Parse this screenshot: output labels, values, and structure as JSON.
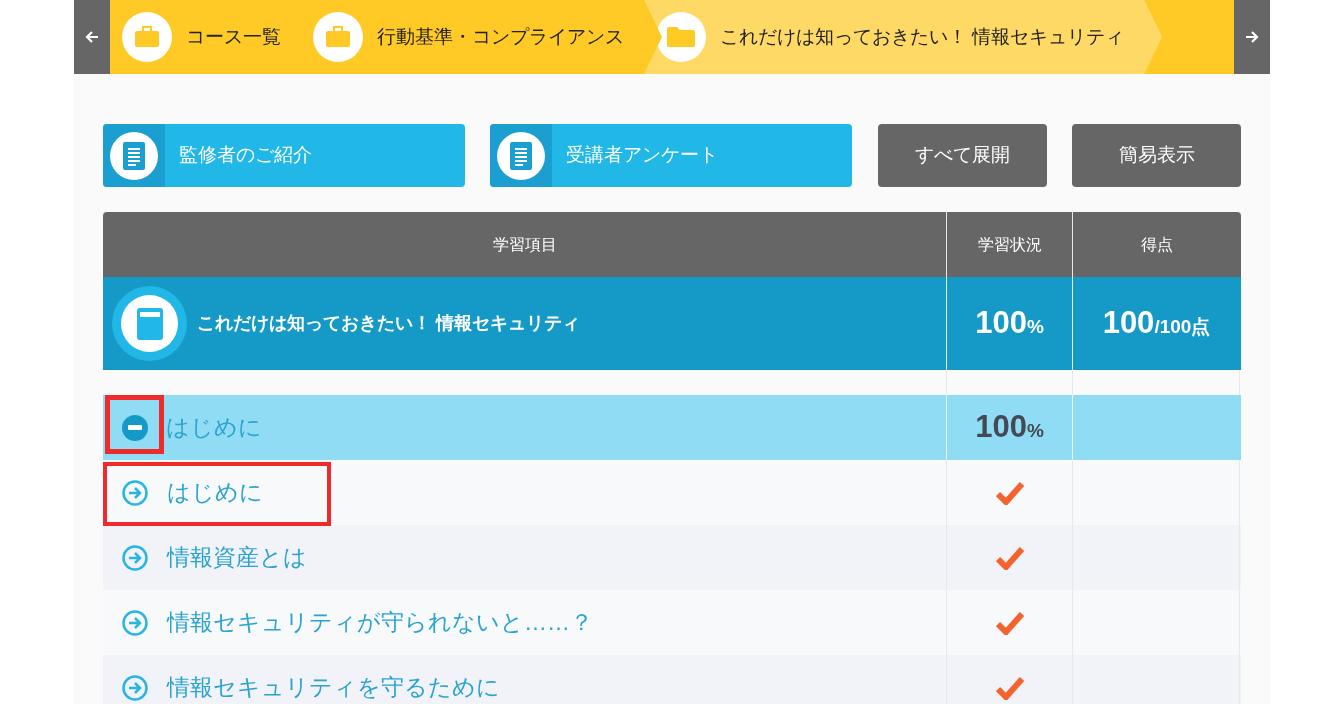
{
  "breadcrumb": {
    "items": [
      {
        "label": "コース一覧",
        "kind": "briefcase",
        "current": false
      },
      {
        "label": "行動基準・コンプライアンス",
        "kind": "briefcase",
        "current": false
      },
      {
        "label": "これだけは知っておきたい！ 情報セキュリティ",
        "kind": "folder",
        "current": true
      }
    ]
  },
  "buttons": [
    {
      "label": "監修者のご紹介",
      "kind": "document"
    },
    {
      "label": "受講者アンケート",
      "kind": "document"
    },
    {
      "label": "すべて展開",
      "kind": "plain"
    },
    {
      "label": "簡易表示",
      "kind": "plain"
    }
  ],
  "table": {
    "columns": [
      "学習項目",
      "学習状況",
      "得点"
    ],
    "course": {
      "title": "これだけは知っておきたい！ 情報セキュリティ",
      "progress": "100",
      "progress_unit": "%",
      "score": "100",
      "score_total": "/100点"
    },
    "sections": [
      {
        "title": "はじめに",
        "expanded": true,
        "highlighted": true,
        "progress": "100",
        "progress_unit": "%",
        "lessons": [
          {
            "title": "はじめに",
            "completed": true,
            "highlighted": true
          },
          {
            "title": "情報資産とは",
            "completed": true,
            "highlighted": false
          },
          {
            "title": "情報セキュリティが守られないと……？",
            "completed": true,
            "highlighted": false
          },
          {
            "title": "情報セキュリティを守るために",
            "completed": true,
            "highlighted": false
          }
        ]
      }
    ]
  }
}
